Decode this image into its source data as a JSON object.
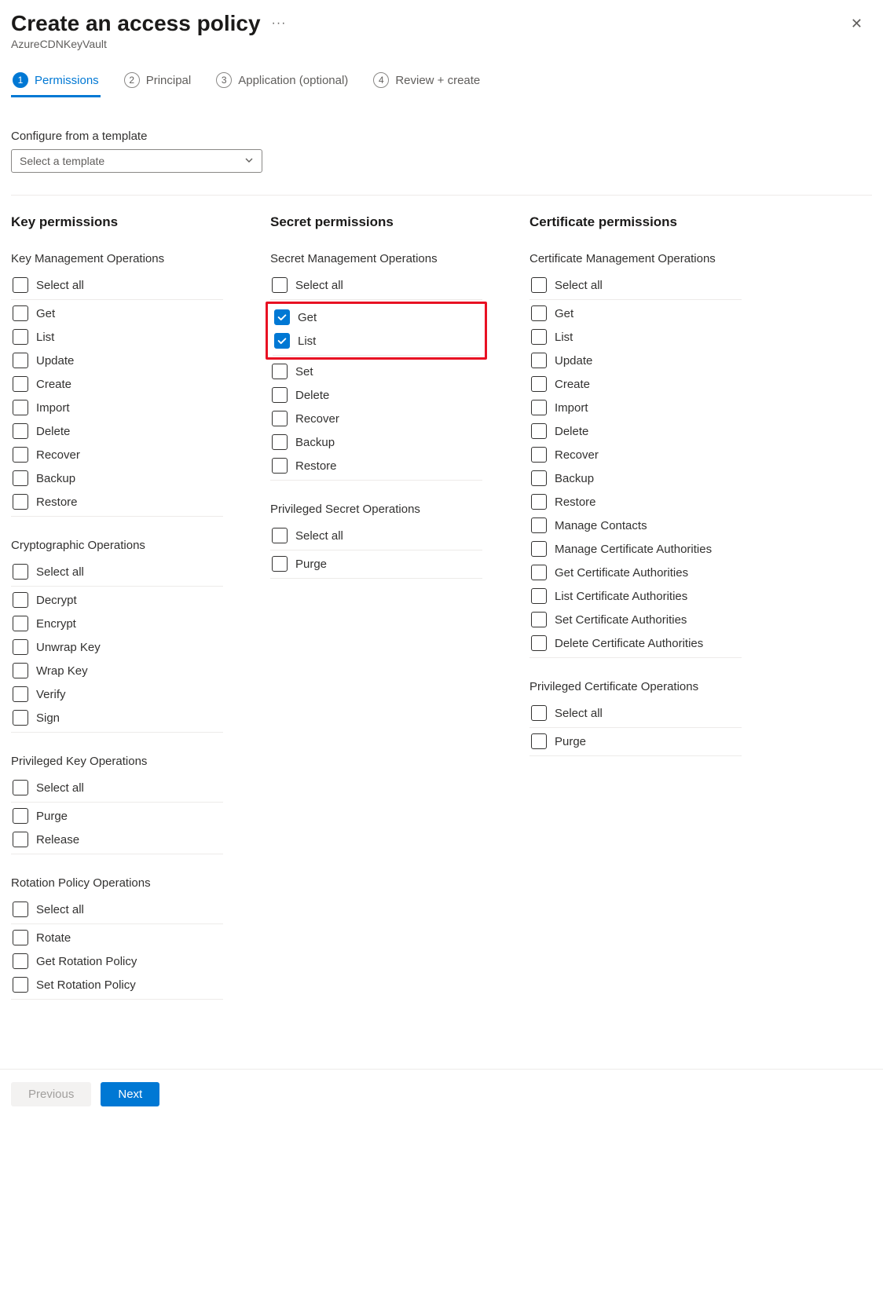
{
  "header": {
    "title": "Create an access policy",
    "subtitle": "AzureCDNKeyVault"
  },
  "tabs": [
    {
      "num": "1",
      "label": "Permissions",
      "active": true
    },
    {
      "num": "2",
      "label": "Principal",
      "active": false
    },
    {
      "num": "3",
      "label": "Application (optional)",
      "active": false
    },
    {
      "num": "4",
      "label": "Review + create",
      "active": false
    }
  ],
  "template": {
    "label": "Configure from a template",
    "placeholder": "Select a template"
  },
  "columns": [
    {
      "title": "Key permissions",
      "groups": [
        {
          "title": "Key Management Operations",
          "selectAll": "Select all",
          "items": [
            {
              "label": "Get",
              "checked": false
            },
            {
              "label": "List",
              "checked": false
            },
            {
              "label": "Update",
              "checked": false
            },
            {
              "label": "Create",
              "checked": false
            },
            {
              "label": "Import",
              "checked": false
            },
            {
              "label": "Delete",
              "checked": false
            },
            {
              "label": "Recover",
              "checked": false
            },
            {
              "label": "Backup",
              "checked": false
            },
            {
              "label": "Restore",
              "checked": false
            }
          ]
        },
        {
          "title": "Cryptographic Operations",
          "selectAll": "Select all",
          "items": [
            {
              "label": "Decrypt",
              "checked": false
            },
            {
              "label": "Encrypt",
              "checked": false
            },
            {
              "label": "Unwrap Key",
              "checked": false
            },
            {
              "label": "Wrap Key",
              "checked": false
            },
            {
              "label": "Verify",
              "checked": false
            },
            {
              "label": "Sign",
              "checked": false
            }
          ]
        },
        {
          "title": "Privileged Key Operations",
          "selectAll": "Select all",
          "items": [
            {
              "label": "Purge",
              "checked": false
            },
            {
              "label": "Release",
              "checked": false
            }
          ]
        },
        {
          "title": "Rotation Policy Operations",
          "selectAll": "Select all",
          "items": [
            {
              "label": "Rotate",
              "checked": false
            },
            {
              "label": "Get Rotation Policy",
              "checked": false
            },
            {
              "label": "Set Rotation Policy",
              "checked": false
            }
          ]
        }
      ]
    },
    {
      "title": "Secret permissions",
      "groups": [
        {
          "title": "Secret Management Operations",
          "selectAll": "Select all",
          "highlight": true,
          "items": [
            {
              "label": "Get",
              "checked": true
            },
            {
              "label": "List",
              "checked": true
            },
            {
              "label": "Set",
              "checked": false
            },
            {
              "label": "Delete",
              "checked": false
            },
            {
              "label": "Recover",
              "checked": false
            },
            {
              "label": "Backup",
              "checked": false
            },
            {
              "label": "Restore",
              "checked": false
            }
          ]
        },
        {
          "title": "Privileged Secret Operations",
          "selectAll": "Select all",
          "items": [
            {
              "label": "Purge",
              "checked": false
            }
          ]
        }
      ]
    },
    {
      "title": "Certificate permissions",
      "groups": [
        {
          "title": "Certificate Management Operations",
          "selectAll": "Select all",
          "items": [
            {
              "label": "Get",
              "checked": false
            },
            {
              "label": "List",
              "checked": false
            },
            {
              "label": "Update",
              "checked": false
            },
            {
              "label": "Create",
              "checked": false
            },
            {
              "label": "Import",
              "checked": false
            },
            {
              "label": "Delete",
              "checked": false
            },
            {
              "label": "Recover",
              "checked": false
            },
            {
              "label": "Backup",
              "checked": false
            },
            {
              "label": "Restore",
              "checked": false
            },
            {
              "label": "Manage Contacts",
              "checked": false
            },
            {
              "label": "Manage Certificate Authorities",
              "checked": false
            },
            {
              "label": "Get Certificate Authorities",
              "checked": false
            },
            {
              "label": "List Certificate Authorities",
              "checked": false
            },
            {
              "label": "Set Certificate Authorities",
              "checked": false
            },
            {
              "label": "Delete Certificate Authorities",
              "checked": false
            }
          ]
        },
        {
          "title": "Privileged Certificate Operations",
          "selectAll": "Select all",
          "items": [
            {
              "label": "Purge",
              "checked": false
            }
          ]
        }
      ]
    }
  ],
  "footer": {
    "previous": "Previous",
    "next": "Next"
  }
}
